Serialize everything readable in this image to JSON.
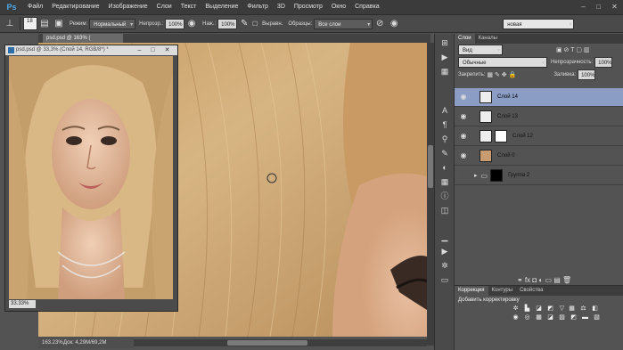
{
  "app": {
    "logo": "Ps"
  },
  "menu": [
    "Файл",
    "Редактирование",
    "Изображение",
    "Слои",
    "Текст",
    "Выделение",
    "Фильтр",
    "3D",
    "Просмотр",
    "Окно",
    "Справка"
  ],
  "options": {
    "brush_size": "18",
    "mode_label": "Режим:",
    "mode_value": "Нормальный",
    "opacity_label": "Непрозр.:",
    "opacity_value": "100%",
    "pressure_label": "Наж.:",
    "pressure_value": "100%",
    "align_label": "Выравн.",
    "sample_label": "Образцы:",
    "sample_value": "Все слои",
    "workspace_value": "новая"
  },
  "document": {
    "tab_title": "psd.psd @ 163% (",
    "zoom": "163.23%",
    "doc_info": "Док: 4,29M/69,2M"
  },
  "float_window": {
    "title": "psd.psd @ 33,3% (Слой 14, RGB/8*) *",
    "zoom": "33.33%"
  },
  "layers_panel": {
    "tabs": [
      "Слои",
      "Каналы"
    ],
    "kind_value": "Вид",
    "blend_value": "Обычные",
    "opacity_label": "Непрозрачность:",
    "opacity_value": "100%",
    "lock_label": "Закрепить:",
    "fill_label": "Заливка:",
    "fill_value": "100%",
    "layers": [
      {
        "name": "Слой 14"
      },
      {
        "name": "Слой 13"
      },
      {
        "name": "Слой 12"
      },
      {
        "name": "Слой 0"
      },
      {
        "name": "Группа 2"
      }
    ]
  },
  "corrections_panel": {
    "tabs": [
      "Коррекция",
      "Контуры",
      "Свойства"
    ],
    "add_label": "Добавить корректировку"
  },
  "colors": {
    "selected_layer": "#8b9dc4",
    "panel_bg": "#535353",
    "menubar_bg": "#3b3b3b"
  }
}
